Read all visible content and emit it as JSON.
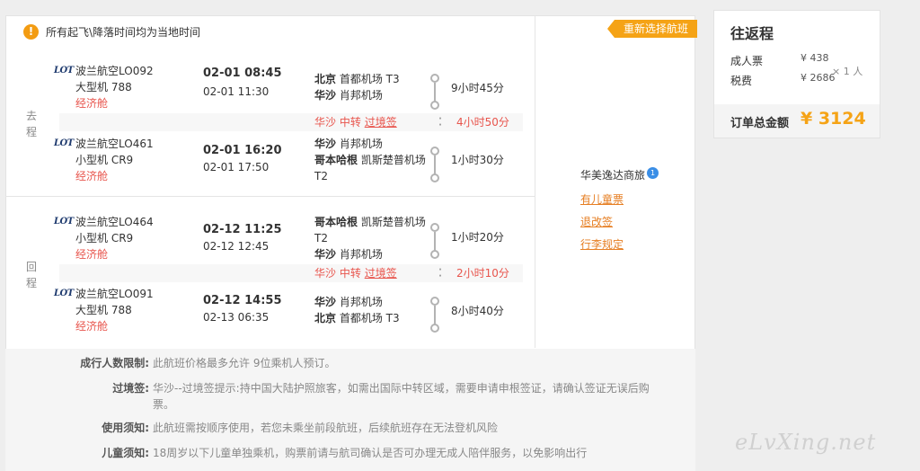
{
  "notice": {
    "text": "所有起飞\\降落时间均为当地时间",
    "icon": "warning-icon"
  },
  "reselect_button": "重新选择航班",
  "outbound_label": "去\n程",
  "return_label": "回\n程",
  "segments": [
    {
      "logo": "LOT",
      "airline": "波兰航空LO092",
      "aircraft": "大型机 788",
      "cabin": "经济舱",
      "dep": "02-01 08:45",
      "arr": "02-01 11:30",
      "from_city": "北京",
      "from_airport": "首都机场 T3",
      "to_city": "华沙",
      "to_airport": "肖邦机场",
      "duration": "9小时45分"
    },
    {
      "logo": "LOT",
      "airline": "波兰航空LO461",
      "aircraft": "小型机 CR9",
      "cabin": "经济舱",
      "dep": "02-01 16:20",
      "arr": "02-01 17:50",
      "from_city": "华沙",
      "from_airport": "肖邦机场",
      "to_city": "哥本哈根",
      "to_airport": "凯斯楚普机场 T2",
      "duration": "1小时30分"
    },
    {
      "logo": "LOT",
      "airline": "波兰航空LO464",
      "aircraft": "小型机 CR9",
      "cabin": "经济舱",
      "dep": "02-12 11:25",
      "arr": "02-12 12:45",
      "from_city": "哥本哈根",
      "from_airport": "凯斯楚普机场 T2",
      "to_city": "华沙",
      "to_airport": "肖邦机场",
      "duration": "1小时20分"
    },
    {
      "logo": "LOT",
      "airline": "波兰航空LO091",
      "aircraft": "大型机 788",
      "cabin": "经济舱",
      "dep": "02-12 14:55",
      "arr": "02-13 06:35",
      "from_city": "华沙",
      "from_airport": "肖邦机场",
      "to_city": "北京",
      "to_airport": "首都机场 T3",
      "duration": "8小时40分"
    }
  ],
  "transfers": [
    {
      "city": "华沙",
      "type": "中转",
      "visa": "过境签",
      "duration": "4小时50分"
    },
    {
      "city": "华沙",
      "type": "中转",
      "visa": "过境签",
      "duration": "2小时10分"
    }
  ],
  "agent": {
    "name": "华美逸达商旅",
    "badge": "1"
  },
  "links": {
    "child": "有儿童票",
    "refund": "退改签",
    "baggage": "行李规定"
  },
  "notes": [
    {
      "label": "成行人数限制:",
      "text": "此航班价格最多允许 9位乘机人预订。"
    },
    {
      "label": "过境签:",
      "text": "华沙--过境签提示:持中国大陆护照旅客，如需出国际中转区域，需要申请申根签证，请确认签证无误后购票。"
    },
    {
      "label": "使用须知:",
      "text": "此航班需按顺序使用，若您未乘坐前段航班，后续航班存在无法登机风险"
    },
    {
      "label": "儿童须知:",
      "text": "18周岁以下儿童单独乘机，购票前请与航司确认是否可办理无成人陪伴服务，以免影响出行"
    }
  ],
  "summary": {
    "title": "往返程",
    "adult_label": "成人票",
    "adult_price": "¥ 438",
    "tax_label": "税费",
    "tax_price": "¥ 2686",
    "multiplier": "× 1 人",
    "total_label": "订单总金额",
    "total_value": "¥ 3124"
  },
  "watermark": "eLvXing.net",
  "colors": {
    "accent": "#f5a316",
    "red": "#e8554d",
    "link": "#e67e22"
  }
}
